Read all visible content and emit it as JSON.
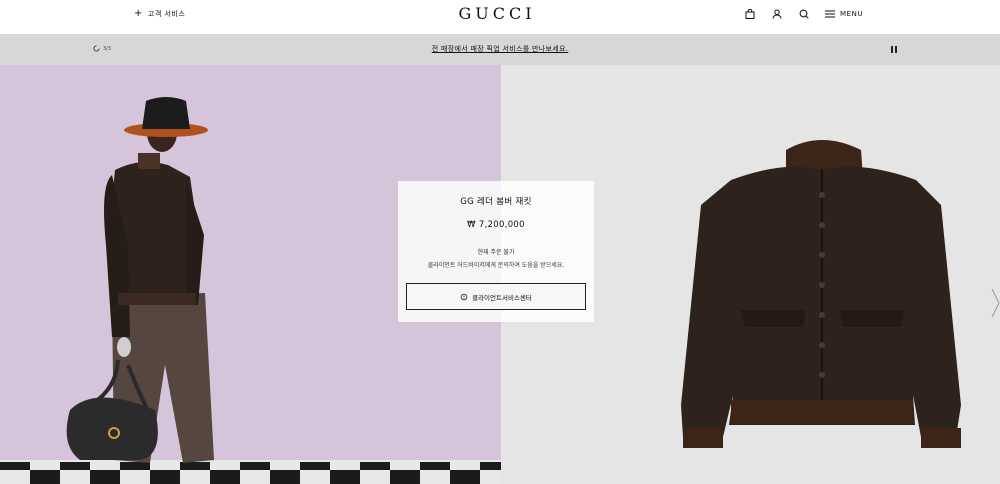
{
  "header": {
    "customer_service": "고객 서비스",
    "logo": "GUCCI",
    "menu_label": "MENU",
    "icons": [
      "shopping-bag-icon",
      "user-icon",
      "search-icon",
      "hamburger-menu-icon"
    ]
  },
  "notice": {
    "counter": "3/3",
    "text": "전 매장에서 매장 픽업 서비스를 만나보세요."
  },
  "product": {
    "name": "GG 레더 봄버 재킷",
    "price": "₩ 7,200,000",
    "availability": "현재 주문 불가",
    "description": "클라이언트 어드바이저에게 문의하여 도움을 받으세요.",
    "cta": "클라이언트서비스센터"
  },
  "colors": {
    "left_bg": "#d6c5da",
    "right_bg": "#e5e5e5",
    "notice_bg": "#d7d7d7",
    "jacket": "#2e221d"
  }
}
